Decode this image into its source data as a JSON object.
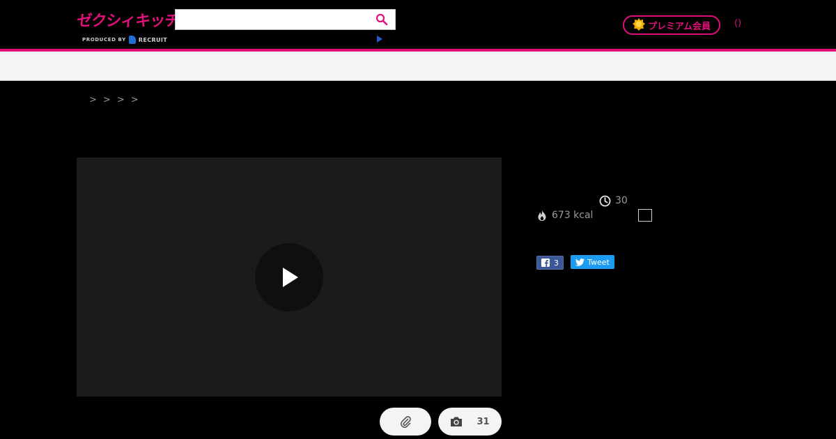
{
  "header": {
    "logo_text": "ゼクシィキッチン",
    "produced_by": "PRODUCED BY",
    "recruit": "RECRUIT",
    "search_placeholder": "",
    "premium_label": "プレミアム会員",
    "paren_link": "()"
  },
  "breadcrumb": {
    "separators": [
      ">",
      ">",
      ">",
      ">"
    ]
  },
  "recipe": {
    "time": "30",
    "kcal": "673 kcal"
  },
  "media": {
    "photo_count": "31"
  },
  "social": {
    "facebook_count": "3",
    "tweet_label": "Tweet"
  },
  "colors": {
    "brand": "#e0107a",
    "facebook": "#3b5998",
    "twitter": "#1d9bf0"
  },
  "icons": {
    "search": "search-icon",
    "play": "play-icon",
    "clip": "paperclip-icon",
    "camera": "camera-icon",
    "clock": "clock-icon",
    "flame": "flame-icon",
    "facebook": "facebook-icon",
    "twitter": "twitter-icon",
    "premium": "premium-medal-icon"
  }
}
